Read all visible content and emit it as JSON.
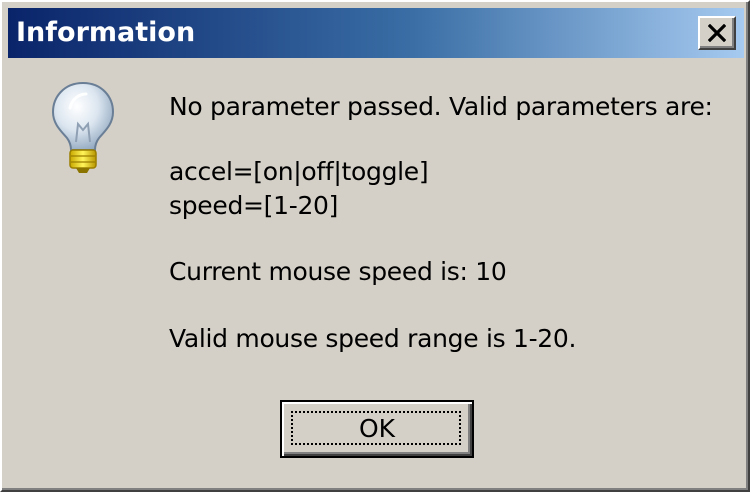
{
  "window": {
    "title": "Information",
    "close_glyph": "X"
  },
  "icon": {
    "name": "lightbulb-info-icon"
  },
  "message": {
    "line1": "No parameter passed.  Valid parameters are:",
    "line2": "accel=[on|off|toggle]",
    "line3": "speed=[1-20]",
    "line4": "Current mouse speed is: 10",
    "line5": "Valid mouse speed range is 1-20."
  },
  "buttons": {
    "ok_label": "OK"
  },
  "colors": {
    "title_gradient_start": "#0a246a",
    "title_gradient_end": "#a6caf0",
    "face": "#d4d0c8"
  }
}
